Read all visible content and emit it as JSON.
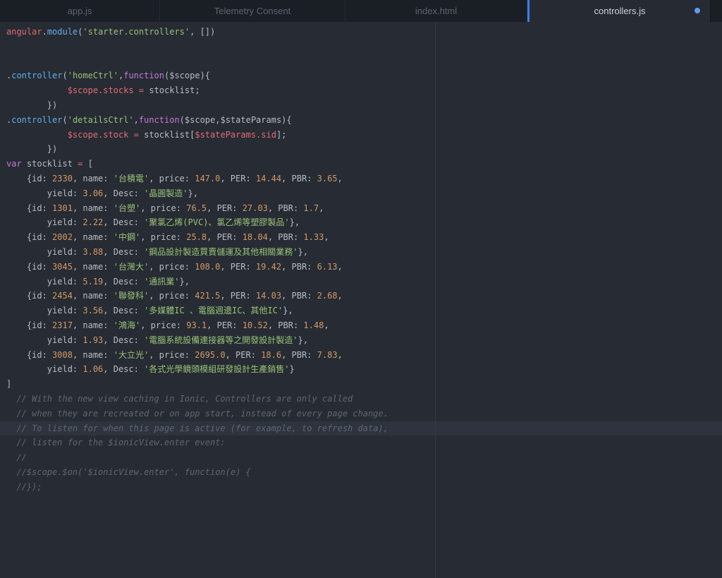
{
  "tabs": [
    {
      "label": "app.js",
      "active": false,
      "dirty": false
    },
    {
      "label": "Telemetry Consent",
      "active": false,
      "dirty": false
    },
    {
      "label": "index.html",
      "active": false,
      "dirty": false
    },
    {
      "label": "controllers.js",
      "active": true,
      "dirty": true
    }
  ],
  "editor": {
    "active_line_index": 27,
    "palette": {
      "plain": "#b6bdc7",
      "variable": "#e06c75",
      "property": "#61afef",
      "string": "#98c379",
      "number": "#d19a66",
      "keyword": "#c678dd",
      "operator": "#e06c75",
      "comment": "#5f6672",
      "accent_blue": "#3e7df6",
      "dirty_dot_blue": "#5c9cf5",
      "background": "#272b33",
      "tabbar_background": "#1a1e25",
      "active_line_background": "#2e333e"
    },
    "lines": [
      [
        [
          "variable",
          "angular"
        ],
        [
          "plain",
          "."
        ],
        [
          "property",
          "module"
        ],
        [
          "plain",
          "("
        ],
        [
          "string",
          "'starter.controllers'"
        ],
        [
          "plain",
          ", [])"
        ]
      ],
      [],
      [],
      [
        [
          "plain",
          "."
        ],
        [
          "property",
          "controller"
        ],
        [
          "plain",
          "("
        ],
        [
          "string",
          "'homeCtrl'"
        ],
        [
          "plain",
          ","
        ],
        [
          "keyword",
          "function"
        ],
        [
          "plain",
          "($scope){"
        ]
      ],
      [
        [
          "plain",
          "            "
        ],
        [
          "variable",
          "$scope.stocks"
        ],
        [
          "plain",
          " "
        ],
        [
          "operator",
          "="
        ],
        [
          "plain",
          " stocklist;"
        ]
      ],
      [
        [
          "plain",
          "        })"
        ]
      ],
      [
        [
          "plain",
          "."
        ],
        [
          "property",
          "controller"
        ],
        [
          "plain",
          "("
        ],
        [
          "string",
          "'detailsCtrl'"
        ],
        [
          "plain",
          ","
        ],
        [
          "keyword",
          "function"
        ],
        [
          "plain",
          "($scope,$stateParams){"
        ]
      ],
      [
        [
          "plain",
          "            "
        ],
        [
          "variable",
          "$scope.stock"
        ],
        [
          "plain",
          " "
        ],
        [
          "operator",
          "="
        ],
        [
          "plain",
          " stocklist["
        ],
        [
          "variable",
          "$stateParams.sid"
        ],
        [
          "plain",
          "];"
        ]
      ],
      [
        [
          "plain",
          "        })"
        ]
      ],
      [
        [
          "keyword",
          "var"
        ],
        [
          "plain",
          " stocklist "
        ],
        [
          "operator",
          "="
        ],
        [
          "plain",
          " ["
        ]
      ],
      [
        [
          "plain",
          "    {id: "
        ],
        [
          "number",
          "2330"
        ],
        [
          "plain",
          ", name: "
        ],
        [
          "string",
          "'台積電'"
        ],
        [
          "plain",
          ", price: "
        ],
        [
          "number",
          "147.0"
        ],
        [
          "plain",
          ", PER: "
        ],
        [
          "number",
          "14.44"
        ],
        [
          "plain",
          ", PBR: "
        ],
        [
          "number",
          "3.65"
        ],
        [
          "plain",
          ","
        ]
      ],
      [
        [
          "plain",
          "        yield: "
        ],
        [
          "number",
          "3.06"
        ],
        [
          "plain",
          ", Desc: "
        ],
        [
          "string",
          "'晶圓製造'"
        ],
        [
          "plain",
          "},"
        ]
      ],
      [
        [
          "plain",
          "    {id: "
        ],
        [
          "number",
          "1301"
        ],
        [
          "plain",
          ", name: "
        ],
        [
          "string",
          "'台塑'"
        ],
        [
          "plain",
          ", price: "
        ],
        [
          "number",
          "76.5"
        ],
        [
          "plain",
          ", PER: "
        ],
        [
          "number",
          "27.03"
        ],
        [
          "plain",
          ", PBR: "
        ],
        [
          "number",
          "1.7"
        ],
        [
          "plain",
          ","
        ]
      ],
      [
        [
          "plain",
          "        yield: "
        ],
        [
          "number",
          "2.22"
        ],
        [
          "plain",
          ", Desc: "
        ],
        [
          "string",
          "'聚氯乙烯(PVC)、氯乙烯等塑膠製品'"
        ],
        [
          "plain",
          "},"
        ]
      ],
      [
        [
          "plain",
          "    {id: "
        ],
        [
          "number",
          "2002"
        ],
        [
          "plain",
          ", name: "
        ],
        [
          "string",
          "'中鋼'"
        ],
        [
          "plain",
          ", price: "
        ],
        [
          "number",
          "25.8"
        ],
        [
          "plain",
          ", PER: "
        ],
        [
          "number",
          "18.04"
        ],
        [
          "plain",
          ", PBR: "
        ],
        [
          "number",
          "1.33"
        ],
        [
          "plain",
          ","
        ]
      ],
      [
        [
          "plain",
          "        yield: "
        ],
        [
          "number",
          "3.88"
        ],
        [
          "plain",
          ", Desc: "
        ],
        [
          "string",
          "'鋼品設計製造買賣儲運及其他相關業務'"
        ],
        [
          "plain",
          "},"
        ]
      ],
      [
        [
          "plain",
          "    {id: "
        ],
        [
          "number",
          "3045"
        ],
        [
          "plain",
          ", name: "
        ],
        [
          "string",
          "'台灣大'"
        ],
        [
          "plain",
          ", price: "
        ],
        [
          "number",
          "108.0"
        ],
        [
          "plain",
          ", PER: "
        ],
        [
          "number",
          "19.42"
        ],
        [
          "plain",
          ", PBR: "
        ],
        [
          "number",
          "6.13"
        ],
        [
          "plain",
          ","
        ]
      ],
      [
        [
          "plain",
          "        yield: "
        ],
        [
          "number",
          "5.19"
        ],
        [
          "plain",
          ", Desc: "
        ],
        [
          "string",
          "'通訊業'"
        ],
        [
          "plain",
          "},"
        ]
      ],
      [
        [
          "plain",
          "    {id: "
        ],
        [
          "number",
          "2454"
        ],
        [
          "plain",
          ", name: "
        ],
        [
          "string",
          "'聯發科'"
        ],
        [
          "plain",
          ", price: "
        ],
        [
          "number",
          "421.5"
        ],
        [
          "plain",
          ", PER: "
        ],
        [
          "number",
          "14.03"
        ],
        [
          "plain",
          ", PBR: "
        ],
        [
          "number",
          "2.68"
        ],
        [
          "plain",
          ","
        ]
      ],
      [
        [
          "plain",
          "        yield: "
        ],
        [
          "number",
          "3.56"
        ],
        [
          "plain",
          ", Desc: "
        ],
        [
          "string",
          "'多媒體IC 、電腦週邊IC、其他IC'"
        ],
        [
          "plain",
          "},"
        ]
      ],
      [
        [
          "plain",
          "    {id: "
        ],
        [
          "number",
          "2317"
        ],
        [
          "plain",
          ", name: "
        ],
        [
          "string",
          "'鴻海'"
        ],
        [
          "plain",
          ", price: "
        ],
        [
          "number",
          "93.1"
        ],
        [
          "plain",
          ", PER: "
        ],
        [
          "number",
          "10.52"
        ],
        [
          "plain",
          ", PBR: "
        ],
        [
          "number",
          "1.48"
        ],
        [
          "plain",
          ","
        ]
      ],
      [
        [
          "plain",
          "        yield: "
        ],
        [
          "number",
          "1.93"
        ],
        [
          "plain",
          ", Desc: "
        ],
        [
          "string",
          "'電腦系統設備連接器等之開發設計製造'"
        ],
        [
          "plain",
          "},"
        ]
      ],
      [
        [
          "plain",
          "    {id: "
        ],
        [
          "number",
          "3008"
        ],
        [
          "plain",
          ", name: "
        ],
        [
          "string",
          "'大立光'"
        ],
        [
          "plain",
          ", price: "
        ],
        [
          "number",
          "2695.0"
        ],
        [
          "plain",
          ", PER: "
        ],
        [
          "number",
          "18.6"
        ],
        [
          "plain",
          ", PBR: "
        ],
        [
          "number",
          "7.83"
        ],
        [
          "plain",
          ","
        ]
      ],
      [
        [
          "plain",
          "        yield: "
        ],
        [
          "number",
          "1.06"
        ],
        [
          "plain",
          ", Desc: "
        ],
        [
          "string",
          "'各式光學鏡頭模組研發設計生產銷售'"
        ],
        [
          "plain",
          "}"
        ]
      ],
      [
        [
          "plain",
          "]"
        ]
      ],
      [
        [
          "comment",
          "  // With the new view caching in Ionic, Controllers are only called"
        ]
      ],
      [
        [
          "comment",
          "  // when they are recreated or on app start, instead of every page change."
        ]
      ],
      [
        [
          "comment",
          "  // To listen for when this page is active (for example, to refresh data),"
        ]
      ],
      [
        [
          "comment",
          "  // listen for the $ionicView.enter event:"
        ]
      ],
      [
        [
          "comment",
          "  //"
        ]
      ],
      [
        [
          "comment",
          "  //$scope.$on('$ionicView.enter', function(e) {"
        ]
      ],
      [
        [
          "comment",
          "  //});"
        ]
      ]
    ]
  }
}
